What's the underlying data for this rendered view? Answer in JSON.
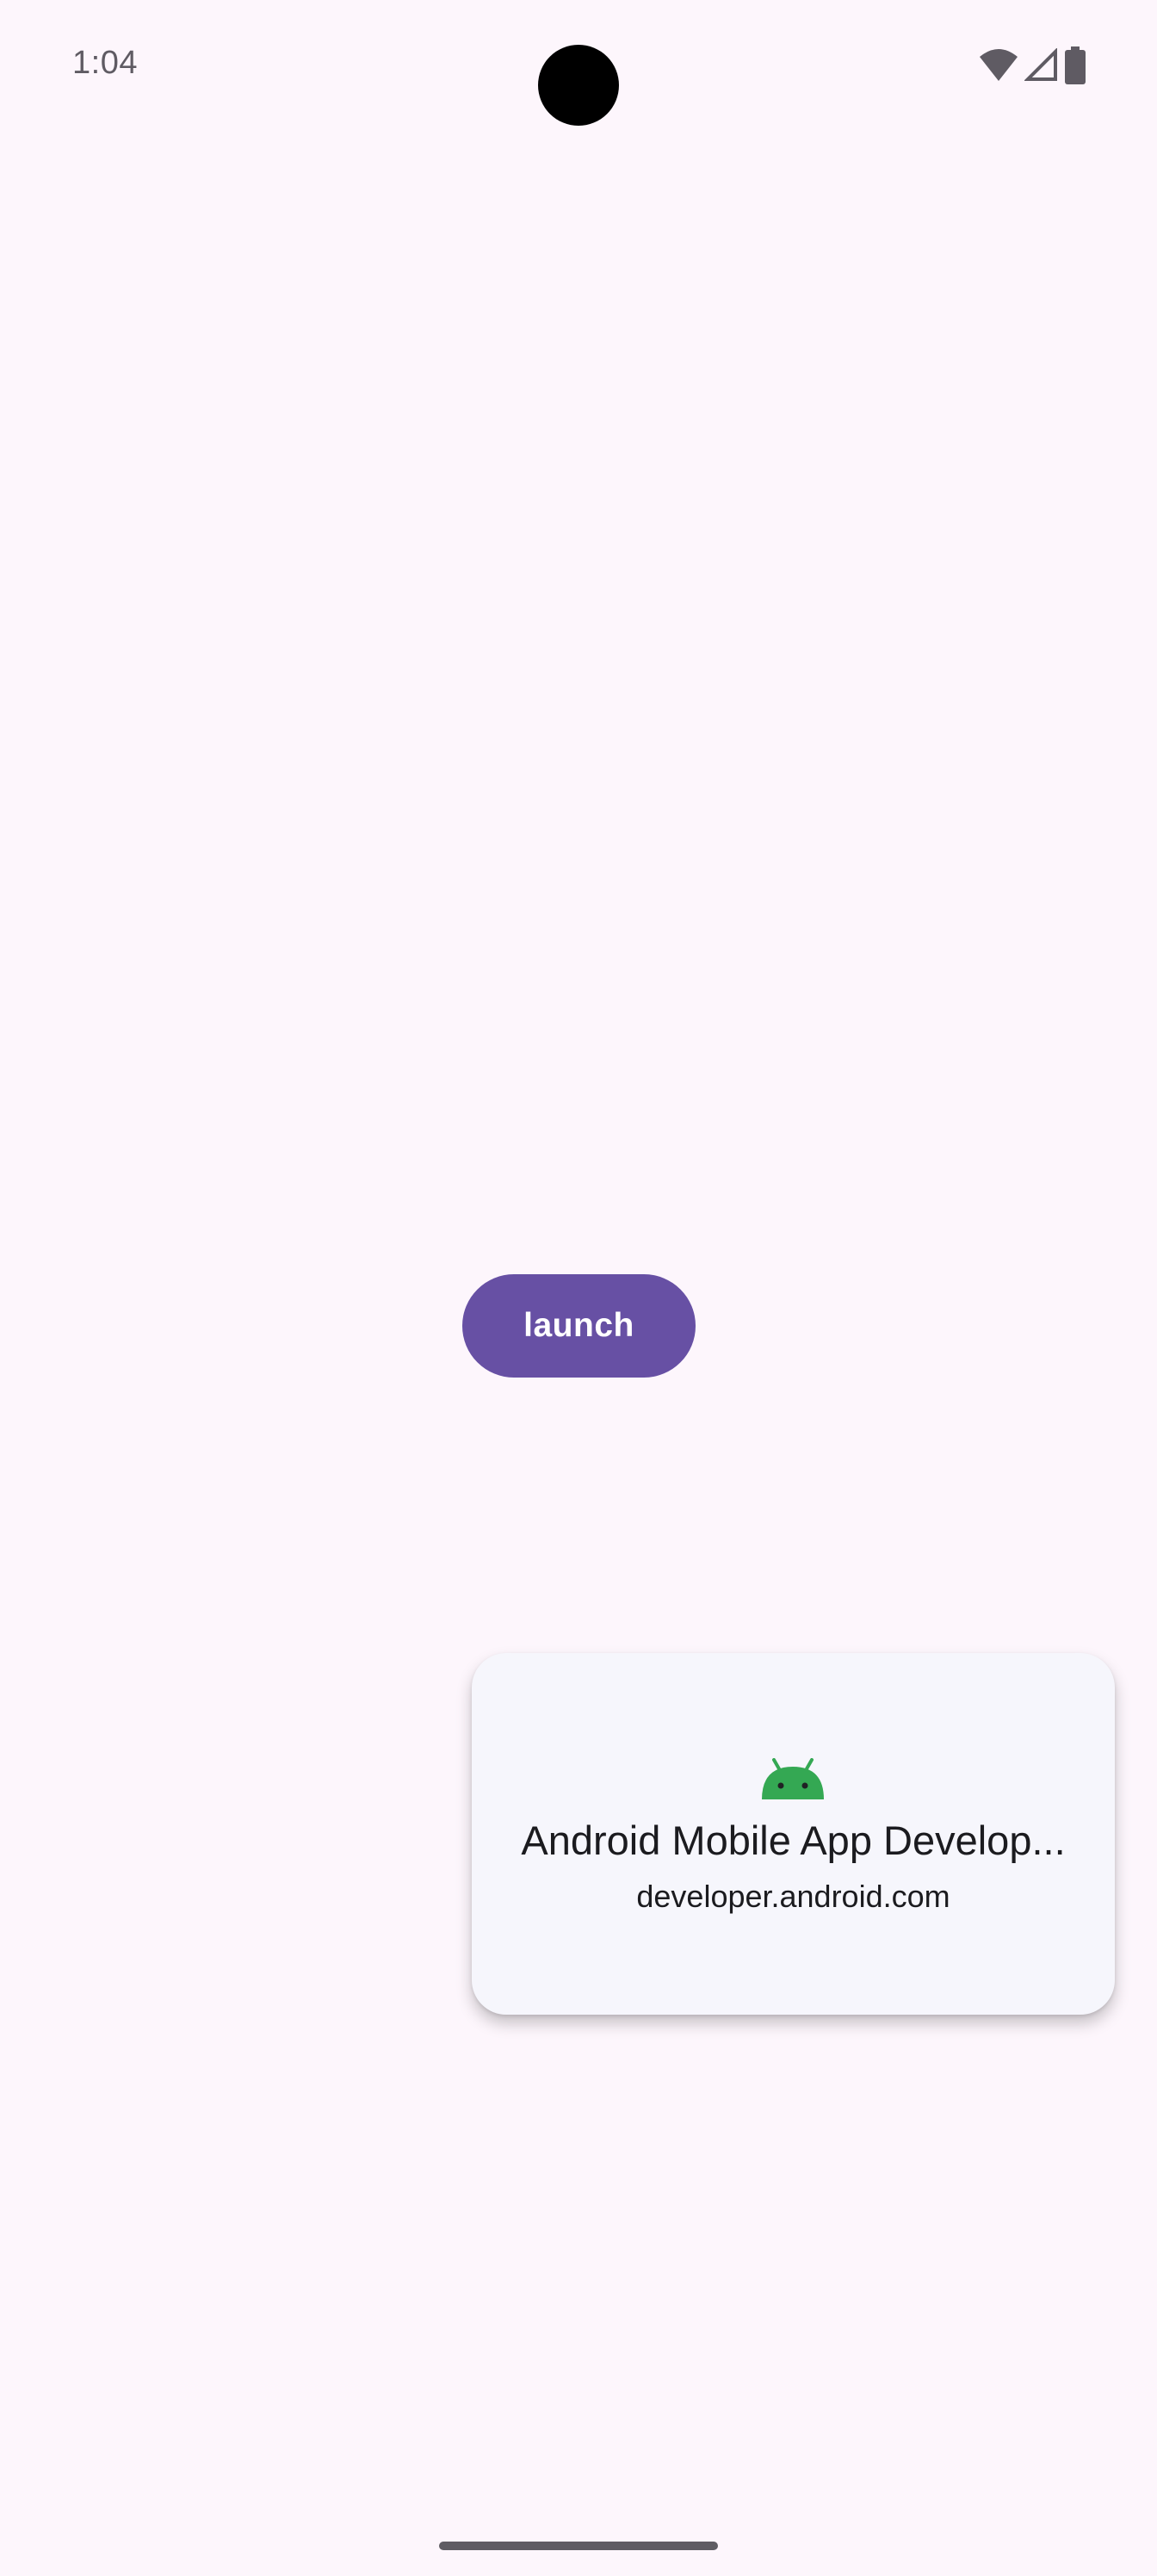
{
  "status_bar": {
    "time": "1:04",
    "icons": [
      "wifi-icon",
      "cell-signal-icon",
      "battery-icon"
    ]
  },
  "main": {
    "launch_label": "launch"
  },
  "link_card": {
    "icon": "android-icon",
    "title": "Android Mobile App Develop...",
    "url": "developer.android.com"
  },
  "colors": {
    "background": "#fdf6fc",
    "primary": "#6750a4",
    "on_primary": "#ffffff",
    "card_surface": "#f6f6fc",
    "android_green": "#34a853"
  }
}
